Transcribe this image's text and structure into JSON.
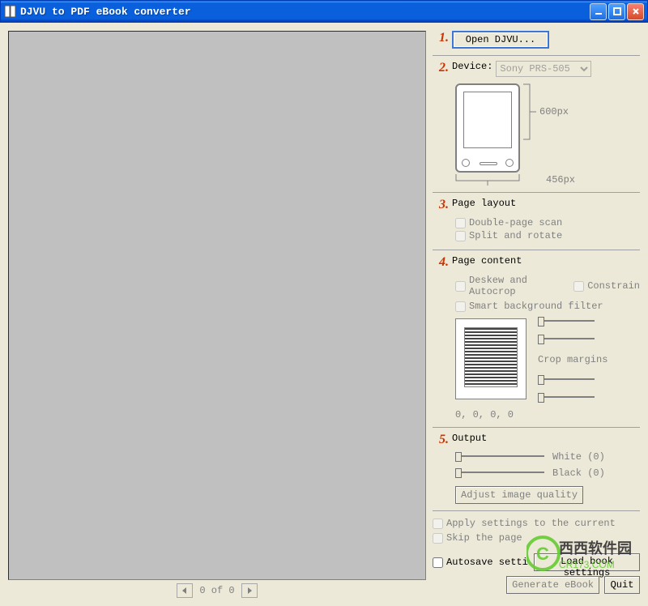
{
  "window": {
    "title": "DJVU to PDF eBook converter"
  },
  "steps": {
    "s1": {
      "num": "1.",
      "open_btn": "Open DJVU..."
    },
    "s2": {
      "num": "2.",
      "label": "Device:",
      "selected": "Sony PRS-505",
      "height_label": "600px",
      "width_label": "456px"
    },
    "s3": {
      "num": "3.",
      "label": "Page layout",
      "opt1": "Double-page scan",
      "opt2": "Split and rotate"
    },
    "s4": {
      "num": "4.",
      "label": "Page content",
      "opt1": "Deskew and Autocrop",
      "opt2": "Constrain",
      "opt3": "Smart background filter",
      "crop_label": "Crop margins",
      "crop_values": "0, 0, 0, 0"
    },
    "s5": {
      "num": "5.",
      "label": "Output",
      "white": "White (0)",
      "black": "Black (0)",
      "adjust_btn": "Adjust image quality"
    }
  },
  "options": {
    "apply_current": "Apply settings to the current page only",
    "skip_page": "Skip the page",
    "autosave": "Autosave settings",
    "load_btn": "Load book settings",
    "generate_btn": "Generate eBook",
    "quit_btn": "Quit"
  },
  "pager": {
    "counter": "0 of 0"
  },
  "watermark": {
    "brand": "西西软件园",
    "url": "CR173.COM"
  }
}
